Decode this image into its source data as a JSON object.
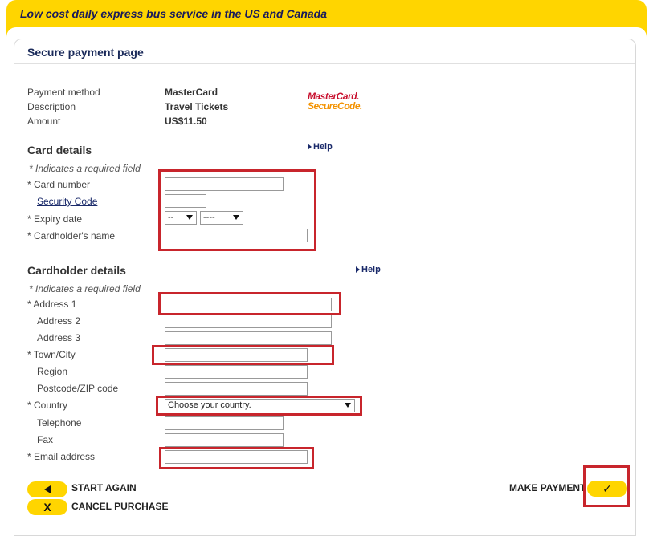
{
  "header": {
    "tagline": "Low cost daily express bus service in the US and Canada"
  },
  "page": {
    "title": "Secure payment page"
  },
  "summary": {
    "payment_method_label": "Payment method",
    "payment_method_value": "MasterCard",
    "description_label": "Description",
    "description_value": "Travel Tickets",
    "amount_label": "Amount",
    "amount_value": "US$11.50",
    "logo_line1": "MasterCard.",
    "logo_line2": "SecureCode."
  },
  "card_details": {
    "heading": "Card details",
    "help": "Help",
    "required_note": "* Indicates a required field",
    "card_number_label": "* Card number",
    "security_code_label": "Security Code",
    "expiry_label": "* Expiry date",
    "expiry_month": "--",
    "expiry_year": "----",
    "cardholder_name_label": "* Cardholder's name"
  },
  "cardholder_details": {
    "heading": "Cardholder details",
    "help": "Help",
    "required_note": "* Indicates a required field",
    "address1_label": "* Address 1",
    "address2_label": "Address 2",
    "address3_label": "Address 3",
    "town_label": "* Town/City",
    "region_label": "Region",
    "postcode_label": "Postcode/ZIP code",
    "country_label": "* Country",
    "country_value": "Choose your country.",
    "telephone_label": "Telephone",
    "fax_label": "Fax",
    "email_label": "* Email address"
  },
  "actions": {
    "start_again": "START AGAIN",
    "cancel_purchase": "CANCEL PURCHASE",
    "make_payment": "MAKE PAYMENT",
    "cancel_glyph": "X",
    "confirm_glyph": "✓"
  },
  "colors": {
    "brand_yellow": "#FFD500",
    "highlight_red": "#c8252c",
    "heading_navy": "#1a2a5a"
  }
}
